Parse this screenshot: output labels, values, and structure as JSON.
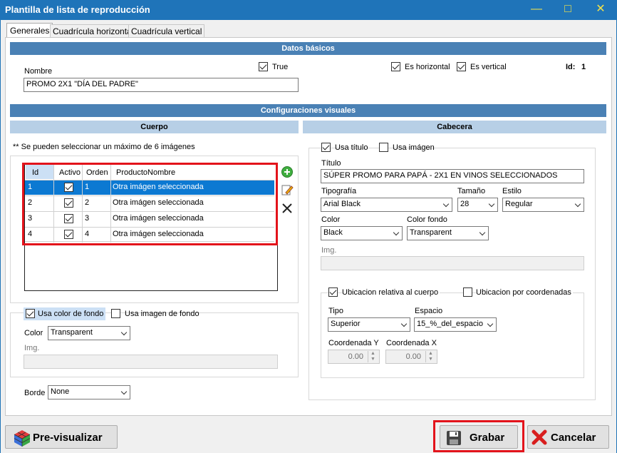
{
  "window": {
    "title": "Plantilla de lista de reproducción"
  },
  "tabs": [
    "Generales",
    "Cuadrícula horizontal",
    "Cuadrícula vertical"
  ],
  "basic": {
    "header": "Datos básicos",
    "name_label": "Nombre",
    "name_value": "PROMO 2X1 \"DÍA DEL PADRE\"",
    "true_label": "True",
    "horizontal_label": "Es horizontal",
    "vertical_label": "Es vertical",
    "id_label": "Id:",
    "id_value": "1"
  },
  "visual": {
    "header": "Configuraciones visuales"
  },
  "body": {
    "header": "Cuerpo",
    "note": "** Se pueden seleccionar un máximo de 6 imágenes",
    "columns": [
      "Id",
      "Activo",
      "Orden",
      "ProductoNombre"
    ],
    "rows": [
      {
        "id": "1",
        "orden": "1",
        "name": "Otra imágen seleccionada"
      },
      {
        "id": "2",
        "orden": "2",
        "name": "Otra imágen seleccionada"
      },
      {
        "id": "3",
        "orden": "3",
        "name": "Otra imágen seleccionada"
      },
      {
        "id": "4",
        "orden": "4",
        "name": "Otra imágen seleccionada"
      }
    ],
    "use_bg_color_label": "Usa color de fondo",
    "use_bg_image_label": "Usa imagen de fondo",
    "color_label": "Color",
    "color_value": "Transparent",
    "img_label": "Img.",
    "border_label": "Borde",
    "border_value": "None"
  },
  "head": {
    "header": "Cabecera",
    "use_title_label": "Usa título",
    "use_image_label": "Usa imágen",
    "title_label": "Título",
    "title_value": "SÚPER PROMO PARA PAPÁ - 2X1 EN VINOS SELECCIONADOS",
    "font_label": "Tipografía",
    "font_value": "Arial Black",
    "size_label": "Tamaño",
    "size_value": "28",
    "style_label": "Estilo",
    "style_value": "Regular",
    "color_label": "Color",
    "color_value": "Black",
    "bgcolor_label": "Color fondo",
    "bgcolor_value": "Transparent",
    "img_label": "Img.",
    "rel_label": "Ubicacion relativa al cuerpo",
    "coord_label": "Ubicacion por coordenadas",
    "type_label": "Tipo",
    "type_value": "Superior",
    "space_label": "Espacio",
    "space_value": "15_%_del_espacio",
    "coord_y_label": "Coordenada Y",
    "coord_y_value": "0.00",
    "coord_x_label": "Coordenada X",
    "coord_x_value": "0.00"
  },
  "buttons": {
    "preview": "Pre-visualizar",
    "save": "Grabar",
    "cancel": "Cancelar"
  },
  "colors": {
    "titlebar": "#1f74b9",
    "band_dark": "#4a81b5",
    "band_light": "#b7cfe6",
    "selection": "#0c79d2",
    "highlight": "#e3131b"
  }
}
